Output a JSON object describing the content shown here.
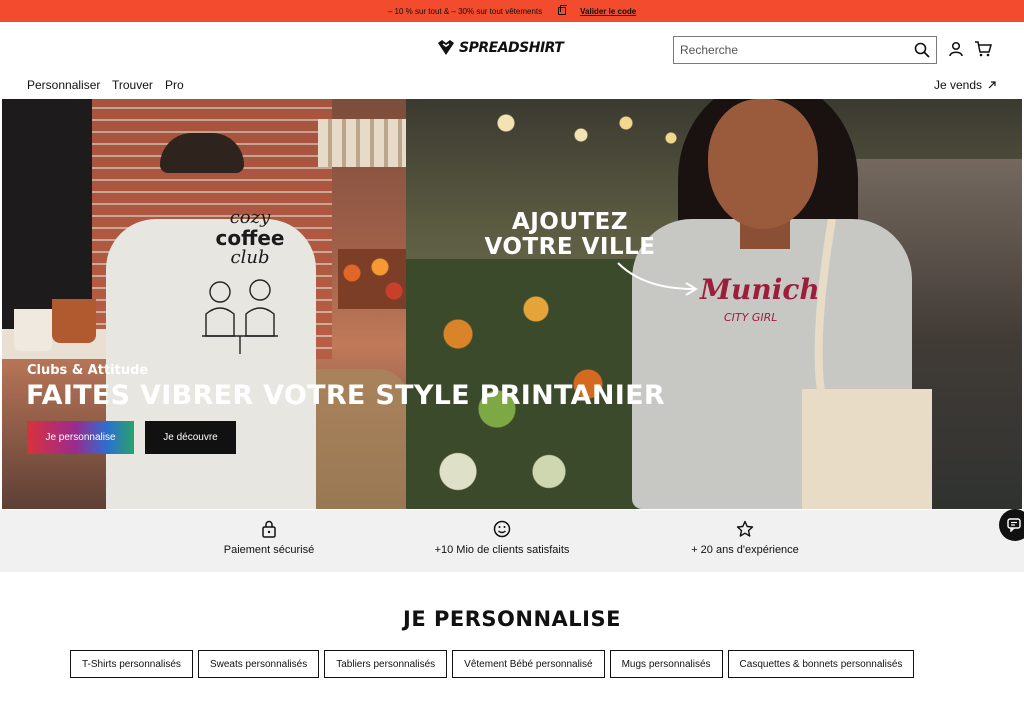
{
  "promo": {
    "text": "– 10 % sur tout & – 30% sur tout vêtements",
    "link": "Valider le code"
  },
  "header": {
    "logo": "SPREADSHIRT",
    "search_placeholder": "Recherche"
  },
  "nav": {
    "items": [
      "Personnaliser",
      "Trouver",
      "Pro"
    ],
    "sell": "Je vends"
  },
  "hero": {
    "overlay_line1": "AJOUTEZ",
    "overlay_line2": "VOTRE VILLE",
    "shirt_left": [
      "cozy",
      "coffee",
      "club"
    ],
    "shirt_right_main": "Munich",
    "shirt_right_sub": "CITY GIRL",
    "subtitle": "Clubs & Attitude",
    "title": "FAITES VIBRER VOTRE STYLE PRINTANIER",
    "btn_primary": "Je personnalise",
    "btn_secondary": "Je découvre"
  },
  "trust": [
    {
      "icon": "lock-icon",
      "label": "Paiement sécurisé"
    },
    {
      "icon": "smiley-icon",
      "label": "+10 Mio de clients satisfaits"
    },
    {
      "icon": "star-icon",
      "label": "+ 20 ans d'expérience"
    }
  ],
  "section": {
    "title": "JE PERSONNALISE",
    "chips": [
      "T-Shirts personnalisés",
      "Sweats personnalisés",
      "Tabliers personnalisés",
      "Vêtement Bébé personnalisé",
      "Mugs personnalisés",
      "Casquettes & bonnets personnalisés"
    ]
  },
  "colors": {
    "promo_bg": "#f24b2d",
    "text": "#111111",
    "trust_bg": "#f1f1f1"
  }
}
